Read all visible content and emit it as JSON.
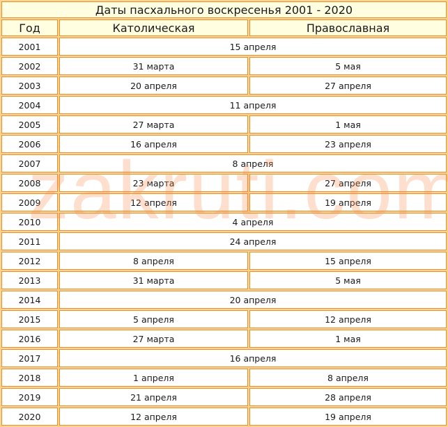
{
  "title": "Даты пасхального воскресенья 2001 - 2020",
  "headers": {
    "year": "Год",
    "catholic": "Католическая",
    "orthodox": "Православная"
  },
  "rows": [
    {
      "year": "2001",
      "common": "15 апреля"
    },
    {
      "year": "2002",
      "catholic": "31 марта",
      "orthodox": "5 мая"
    },
    {
      "year": "2003",
      "catholic": "20 апреля",
      "orthodox": "27 апреля"
    },
    {
      "year": "2004",
      "common": "11 апреля"
    },
    {
      "year": "2005",
      "catholic": "27 марта",
      "orthodox": "1 мая"
    },
    {
      "year": "2006",
      "catholic": "16 апреля",
      "orthodox": "23 апреля"
    },
    {
      "year": "2007",
      "common": "8 апреля"
    },
    {
      "year": "2008",
      "catholic": "23 марта",
      "orthodox": "27 апреля"
    },
    {
      "year": "2009",
      "catholic": "12 апреля",
      "orthodox": "19 апреля"
    },
    {
      "year": "2010",
      "common": "4 апреля"
    },
    {
      "year": "2011",
      "common": "24 апреля"
    },
    {
      "year": "2012",
      "catholic": "8 апреля",
      "orthodox": "15 апреля"
    },
    {
      "year": "2013",
      "catholic": "31 марта",
      "orthodox": "5 мая"
    },
    {
      "year": "2014",
      "common": "20 апреля"
    },
    {
      "year": "2015",
      "catholic": "5 апреля",
      "orthodox": "12 апреля"
    },
    {
      "year": "2016",
      "catholic": "27 марта",
      "orthodox": "1 мая"
    },
    {
      "year": "2017",
      "common": "16 апреля"
    },
    {
      "year": "2018",
      "catholic": "1 апреля",
      "orthodox": "8 апреля"
    },
    {
      "year": "2019",
      "catholic": "21 апреля",
      "orthodox": "28 апреля"
    },
    {
      "year": "2020",
      "catholic": "12 апреля",
      "orthodox": "19 апреля"
    }
  ],
  "watermark": "zakruti.com",
  "colors": {
    "table_bg": "#fcd490",
    "cell_border": "#e8902e",
    "header_bg": "#fffee0",
    "body_bg": "#ffffff"
  }
}
